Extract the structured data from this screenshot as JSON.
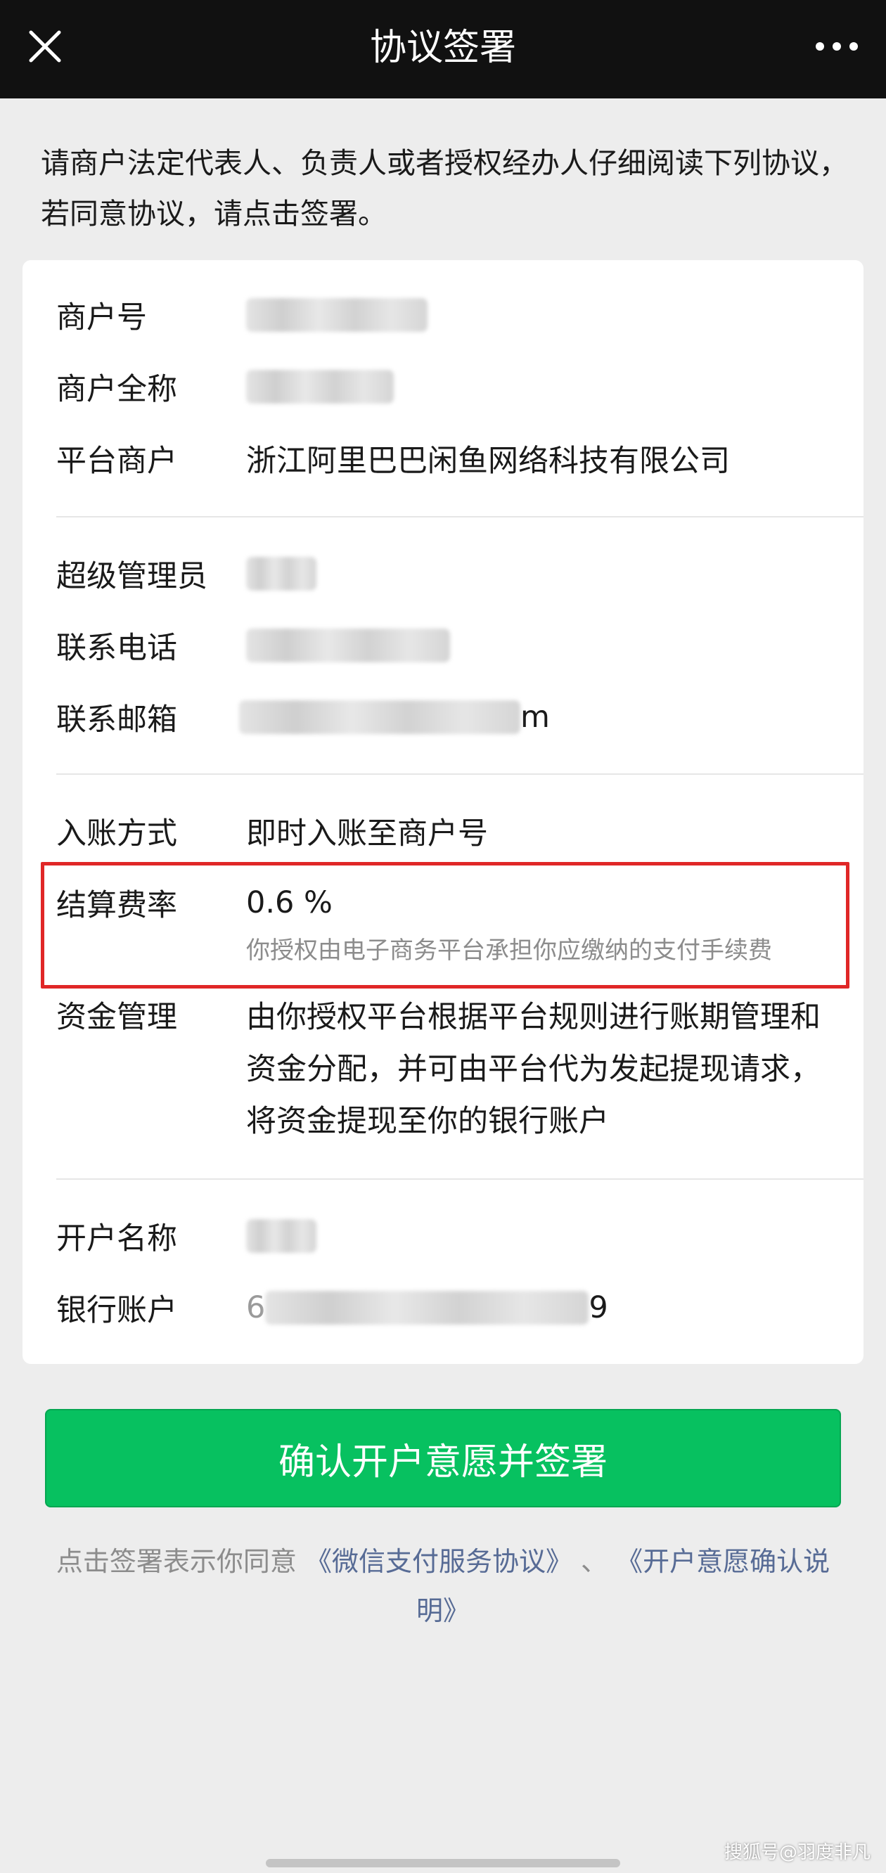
{
  "nav": {
    "title": "协议签署",
    "close_icon": "close-icon",
    "more_icon": "more-icon"
  },
  "intro": "请商户法定代表人、负责人或者授权经办人仔细阅读下列协议，若同意协议，请点击签署。",
  "card": {
    "merchant_no": {
      "label": "商户号",
      "value": ""
    },
    "merchant_name": {
      "label": "商户全称",
      "value": ""
    },
    "platform_merchant": {
      "label": "平台商户",
      "value": "浙江阿里巴巴闲鱼网络科技有限公司"
    },
    "super_admin": {
      "label": "超级管理员",
      "value": ""
    },
    "contact_phone": {
      "label": "联系电话",
      "value": ""
    },
    "contact_email": {
      "label": "联系邮箱",
      "value_suffix": "m"
    },
    "settlement_method": {
      "label": "入账方式",
      "value": "即时入账至商户号"
    },
    "fee_rate": {
      "label": "结算费率",
      "value": "0.6 %",
      "note": "你授权由电子商务平台承担你应缴纳的支付手续费"
    },
    "fund_management": {
      "label": "资金管理",
      "value": "由你授权平台根据平台规则进行账期管理和资金分配，并可由平台代为发起提现请求，将资金提现至你的银行账户"
    },
    "account_name": {
      "label": "开户名称",
      "value": ""
    },
    "bank_account": {
      "label": "银行账户",
      "value_prefix": "6",
      "value_suffix": "9"
    }
  },
  "confirm_button": "确认开户意愿并签署",
  "agreement": {
    "prefix": "点击签署表示你同意",
    "link1": "《微信支付服务协议》",
    "separator": "、",
    "link2": "《开户意愿确认说明》"
  },
  "watermark": "搜狐号@羽度非凡",
  "colors": {
    "nav_bg": "#111111",
    "page_bg": "#ededed",
    "primary_green": "#07c160",
    "link_blue": "#576b95",
    "highlight_red": "#e02727"
  }
}
